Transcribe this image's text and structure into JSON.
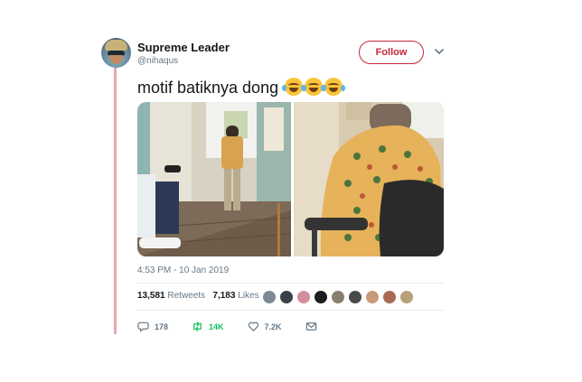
{
  "user": {
    "display_name": "Supreme Leader",
    "handle": "@nihaqus"
  },
  "follow_label": "Follow",
  "tweet": {
    "text": "motif batiknya dong",
    "emoji_count": 3,
    "timestamp": "4:53 PM - 10 Jan 2019"
  },
  "stats": {
    "retweets_count": "13,581",
    "retweets_label": "Retweets",
    "likes_count": "7,183",
    "likes_label": "Likes"
  },
  "actions": {
    "replies": "178",
    "retweets": "14K",
    "likes": "7.2K"
  },
  "colors": {
    "accent": "#c8283c",
    "thread": "#e8a9b2",
    "retweet": "#17bf63",
    "muted": "#657786"
  },
  "icons": {
    "reply": "reply-icon",
    "retweet": "retweet-icon",
    "like": "heart-icon",
    "dm": "envelope-icon",
    "more": "chevron-down-icon"
  }
}
